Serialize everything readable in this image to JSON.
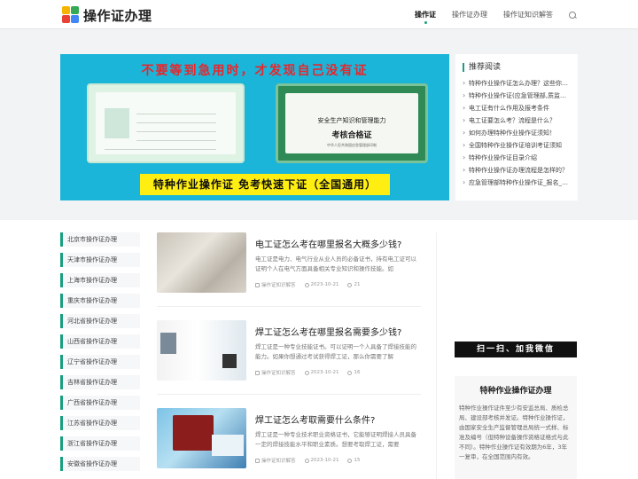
{
  "header": {
    "site_title": "操作证办理",
    "nav": [
      "操作证",
      "操作证办理",
      "操作证知识解答"
    ]
  },
  "banner": {
    "top_text": "不要等到急用时，才发现自己没有证",
    "cert_title_line1": "安全生产知识和管理能力",
    "cert_title_line2": "考核合格证",
    "cert_footer": "中华人民共和国应急管理部印制",
    "bottom_text": "特种作业操作证  免考快速下证（全国通用）"
  },
  "recommend": {
    "title": "推荐阅读",
    "items": [
      "特种作业操作证怎么办理？这些你必须知道",
      "特种作业操作证(应急管理部,质监局,建委)",
      "电工证有什么作用及报考条件",
      "电工证要怎么考？流程是什么？",
      "如何办理特种作业操作证须知！",
      "全国特种作业操作证培训考证须知",
      "特种作业操作证目录介绍",
      "特种作业操作证办理流程是怎样的？",
      "应急管理部特种作业操作证_报名_培训_考试"
    ]
  },
  "side_nav": [
    "北京市操作证办理",
    "天津市操作证办理",
    "上海市操作证办理",
    "重庆市操作证办理",
    "河北省操作证办理",
    "山西省操作证办理",
    "辽宁省操作证办理",
    "吉林省操作证办理",
    "广西省操作证办理",
    "江苏省操作证办理",
    "浙江省操作证办理",
    "安徽省操作证办理"
  ],
  "articles": [
    {
      "title": "电工证怎么考在哪里报名大概多少钱?",
      "desc": "电工证是电力、电气行业从业人员的必备证书，持有电工证可以证明个人在电气方面具备相关专业知识和操作技能。如",
      "category": "操作证知识解答",
      "date": "2023-10-21",
      "views": "21"
    },
    {
      "title": "焊工证怎么考在哪里报名需要多少钱?",
      "desc": "焊工证是一种专业技能证书。可以证明一个人具备了焊接技能的能力。如果你想通过考试获得焊工证，那么你需要了解",
      "category": "操作证知识解答",
      "date": "2023-10-21",
      "views": "16"
    },
    {
      "title": "焊工证怎么考取需要什么条件?",
      "desc": "焊工证是一种专业技术职业资格证书，它能够证明焊接人员具备一定的焊接技能水平和职业素质。想要考取焊工证，需要",
      "category": "操作证知识解答",
      "date": "2023-10-21",
      "views": "15"
    }
  ],
  "wechat": {
    "banner_text": "扫一扫、加我微信",
    "box_title": "特种作业操作证办理",
    "box_text": "特种作业操作证件至少有安监总局、质检总局、建设部考核并发证。特种作业操作证，由国家安全生产监督管理总局统一式样、标准及编号（但特种设备操作资格证格式与此不同）。特种作业操作证有效期为6年，3年一复审，在全国范围内有效。"
  },
  "colors": {
    "accent": "#1a9e7f",
    "banner_bg": "#1bb5d9",
    "banner_red": "#e8262b",
    "banner_yellow": "#ffee11"
  }
}
